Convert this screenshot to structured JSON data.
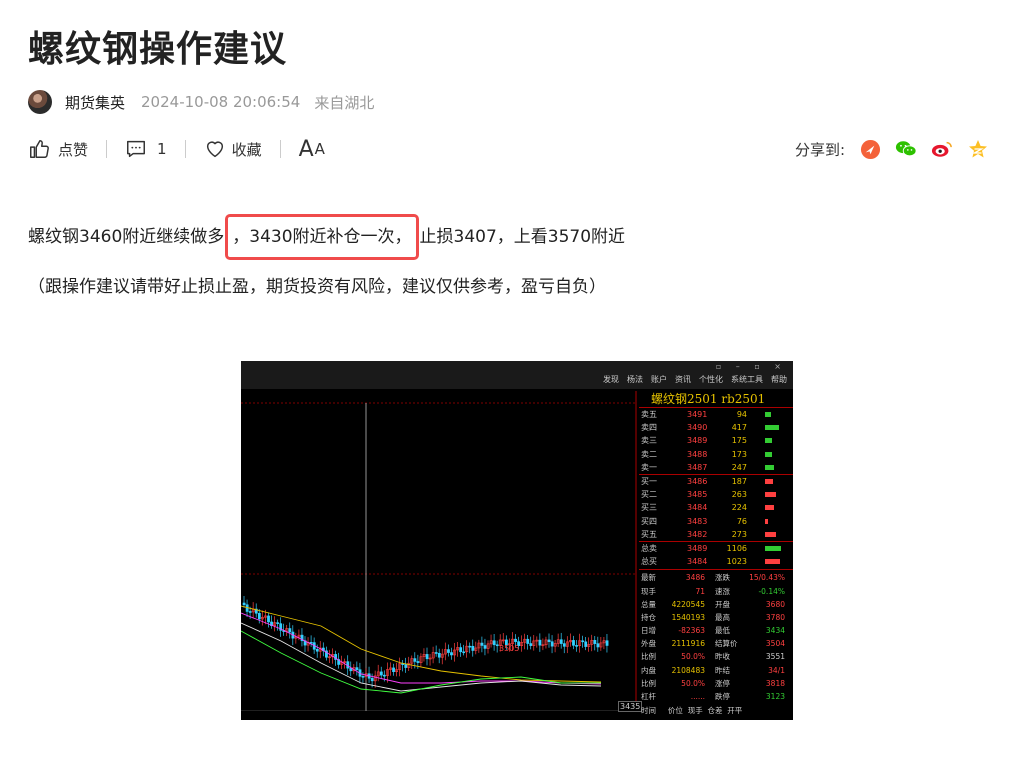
{
  "article": {
    "title": "螺纹钢操作建议",
    "author": "期货集英",
    "datetime": "2024-10-08 20:06:54",
    "location": "来自湖北",
    "paragraph1": {
      "before": "螺纹钢3460附近继续做多",
      "highlight": "，3430附近补仓一次，",
      "after": "止损3407，上看3570附近"
    },
    "paragraph2": "（跟操作建议请带好止损止盈，期货投资有风险，建议仅供参考，盈亏自负）"
  },
  "actions": {
    "like_label": "点赞",
    "comment_count": "1",
    "favorite_label": "收藏",
    "fontsize_big": "A",
    "fontsize_small": "A"
  },
  "share": {
    "label": "分享到:",
    "icons": [
      "zhihu-icon",
      "wechat-icon",
      "weibo-icon",
      "qzone-icon"
    ]
  },
  "colors": {
    "highlight_border": "#f04b4b",
    "rise": "#ff4040",
    "fall": "#33cc33",
    "ma": "#e6c200"
  },
  "chart_image": {
    "menu": [
      "发现",
      "杨法",
      "账户",
      "资讯",
      "个性化",
      "系统工具",
      "帮助"
    ],
    "contract": "螺纹钢2501  rb2501",
    "orderbook": [
      {
        "name": "卖五",
        "price": "3491",
        "vol": "94"
      },
      {
        "name": "卖四",
        "price": "3490",
        "vol": "417"
      },
      {
        "name": "卖三",
        "price": "3489",
        "vol": "175"
      },
      {
        "name": "卖二",
        "price": "3488",
        "vol": "173"
      },
      {
        "name": "卖一",
        "price": "3487",
        "vol": "247"
      },
      {
        "name": "买一",
        "price": "3486",
        "vol": "187"
      },
      {
        "name": "买二",
        "price": "3485",
        "vol": "263"
      },
      {
        "name": "买三",
        "price": "3484",
        "vol": "224"
      },
      {
        "name": "买四",
        "price": "3483",
        "vol": "76"
      },
      {
        "name": "买五",
        "price": "3482",
        "vol": "273"
      },
      {
        "name": "总卖",
        "price": "3489",
        "vol": "1106"
      },
      {
        "name": "总买",
        "price": "3484",
        "vol": "1023"
      }
    ],
    "stats": [
      {
        "k": "最新",
        "a": "3486",
        "k2": "涨跌",
        "b": "15/0.43%"
      },
      {
        "k": "现手",
        "a": "71",
        "k2": "速涨",
        "b": "-0.14%"
      },
      {
        "k": "总量",
        "a": "4220545",
        "k2": "开盘",
        "b": "3680"
      },
      {
        "k": "持仓",
        "a": "1540193",
        "k2": "最高",
        "b": "3780"
      },
      {
        "k": "日增",
        "a": "-82363",
        "k2": "最低",
        "b": "3434"
      },
      {
        "k": "外盘",
        "a": "2111916",
        "k2": "结算价",
        "b": "3504"
      },
      {
        "k": "比例",
        "a": "50.0%",
        "k2": "昨收",
        "b": "3551"
      },
      {
        "k": "内盘",
        "a": "2108483",
        "k2": "昨结",
        "b": "34/1"
      },
      {
        "k": "比例",
        "a": "50.0%",
        "k2": "涨停",
        "b": "3818"
      },
      {
        "k": "杠杆",
        "a": "......",
        "k2": "跌停",
        "b": "3123"
      }
    ],
    "marks": {
      "high": "3505",
      "low": "3435",
      "axis_right": "3435"
    },
    "footer": "时间     价位  现手  仓差  开平"
  }
}
